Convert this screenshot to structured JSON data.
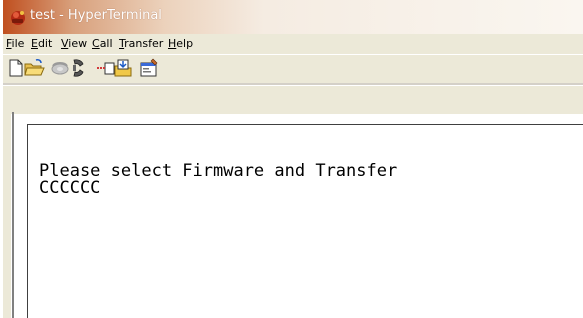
{
  "window": {
    "title": "test - HyperTerminal"
  },
  "menu": {
    "items": [
      {
        "label": "File",
        "underline": "F",
        "rest": "ile"
      },
      {
        "label": "Edit",
        "underline": "E",
        "rest": "dit"
      },
      {
        "label": "View",
        "underline": "V",
        "rest": "iew"
      },
      {
        "label": "Call",
        "underline": "C",
        "rest": "all"
      },
      {
        "label": "Transfer",
        "underline": "T",
        "rest": "ransfer"
      },
      {
        "label": "Help",
        "underline": "H",
        "rest": "elp"
      }
    ]
  },
  "toolbar": {
    "buttons": [
      "new-connection-icon",
      "open-icon",
      "call-icon",
      "disconnect-icon",
      "send-icon",
      "receive-icon",
      "properties-icon"
    ]
  },
  "terminal": {
    "lines": [
      "Please select Firmware and Transfer",
      "CCCCCC"
    ]
  }
}
